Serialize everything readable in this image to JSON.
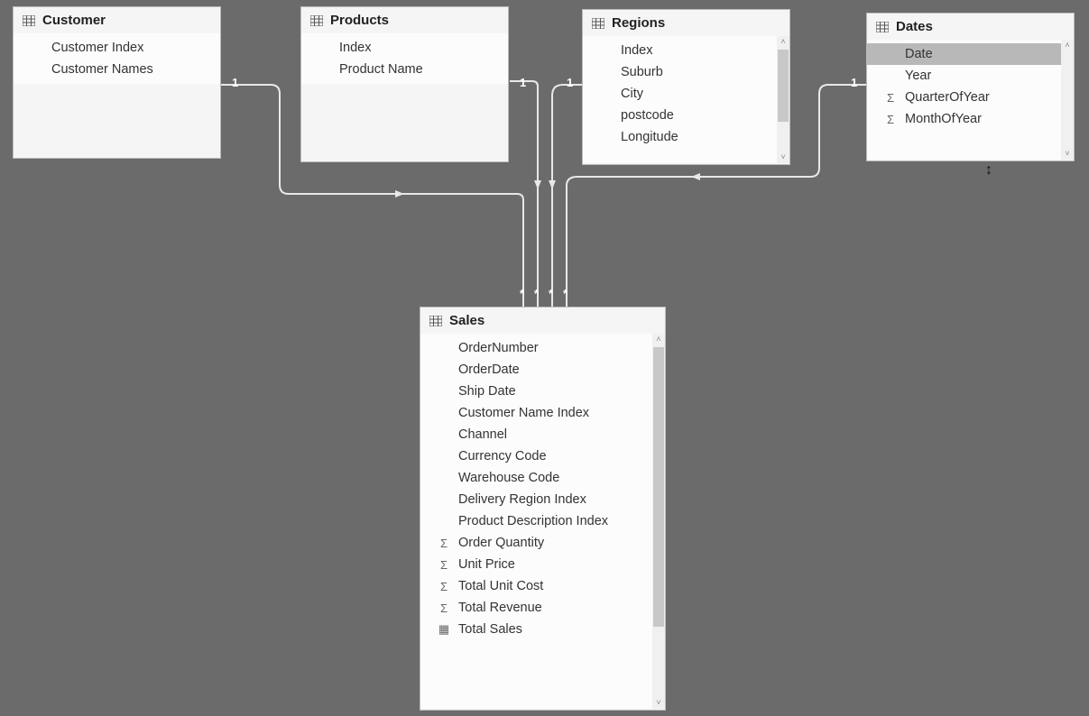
{
  "tables": {
    "customer": {
      "title": "Customer",
      "fields": [
        {
          "label": "Customer Index",
          "icon": ""
        },
        {
          "label": "Customer Names",
          "icon": ""
        }
      ]
    },
    "products": {
      "title": "Products",
      "fields": [
        {
          "label": "Index",
          "icon": ""
        },
        {
          "label": "Product Name",
          "icon": ""
        }
      ]
    },
    "regions": {
      "title": "Regions",
      "fields": [
        {
          "label": "Index",
          "icon": ""
        },
        {
          "label": "Suburb",
          "icon": ""
        },
        {
          "label": "City",
          "icon": ""
        },
        {
          "label": "postcode",
          "icon": ""
        },
        {
          "label": "Longitude",
          "icon": ""
        }
      ]
    },
    "dates": {
      "title": "Dates",
      "fields": [
        {
          "label": "Date",
          "icon": "",
          "selected": true
        },
        {
          "label": "Year",
          "icon": ""
        },
        {
          "label": "QuarterOfYear",
          "icon": "Σ"
        },
        {
          "label": "MonthOfYear",
          "icon": "Σ"
        }
      ]
    },
    "sales": {
      "title": "Sales",
      "fields": [
        {
          "label": "OrderNumber",
          "icon": ""
        },
        {
          "label": "OrderDate",
          "icon": ""
        },
        {
          "label": "Ship Date",
          "icon": ""
        },
        {
          "label": "Customer Name Index",
          "icon": ""
        },
        {
          "label": "Channel",
          "icon": ""
        },
        {
          "label": "Currency Code",
          "icon": ""
        },
        {
          "label": "Warehouse Code",
          "icon": ""
        },
        {
          "label": "Delivery Region Index",
          "icon": ""
        },
        {
          "label": "Product Description Index",
          "icon": ""
        },
        {
          "label": "Order Quantity",
          "icon": "Σ"
        },
        {
          "label": "Unit Price",
          "icon": "Σ"
        },
        {
          "label": "Total Unit Cost",
          "icon": "Σ"
        },
        {
          "label": "Total Revenue",
          "icon": "Σ"
        },
        {
          "label": "Total Sales",
          "icon": "▦"
        }
      ]
    }
  },
  "relationships": {
    "customer_sales": {
      "from_card": "1",
      "to_card": "*"
    },
    "products_sales": {
      "from_card": "1",
      "to_card": "*"
    },
    "regions_sales": {
      "from_card": "1",
      "to_card": "*"
    },
    "dates_sales": {
      "from_card": "1",
      "to_card": "*"
    }
  }
}
